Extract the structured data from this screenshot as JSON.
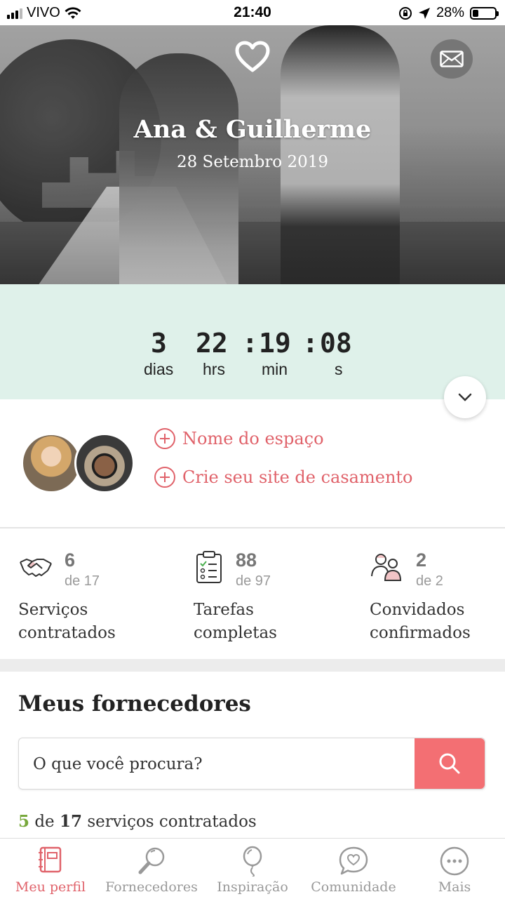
{
  "status_bar": {
    "carrier": "VIVO",
    "time": "21:40",
    "battery_percent": "28%",
    "battery_level": 0.28
  },
  "hero": {
    "couple_name": "Ana & Guilherme",
    "wedding_date": "28 Setembro 2019"
  },
  "countdown": {
    "days": "3",
    "hours": "22",
    "minutes": "19",
    "seconds": "08",
    "days_label": "dias",
    "hours_label": "hrs",
    "minutes_label": "min",
    "seconds_label": "s"
  },
  "profile": {
    "venue_link": "Nome do espaço",
    "website_link": "Crie seu site de casamento"
  },
  "stats": [
    {
      "icon": "handshake-icon",
      "count": "6",
      "total": "de 17",
      "label": "Serviços\ncontratados"
    },
    {
      "icon": "clipboard-checklist-icon",
      "count": "88",
      "total": "de 97",
      "label": "Tarefas\ncompletas"
    },
    {
      "icon": "guests-icon",
      "count": "2",
      "total": "de 2",
      "label": "Convidados\nconfirmados"
    }
  ],
  "vendors": {
    "title": "Meus fornecedores",
    "search_placeholder": "O que você procura?",
    "hired_count": "5",
    "hired_of": "de",
    "hired_total": "17",
    "hired_suffix": "serviços contratados"
  },
  "tabs": [
    {
      "label": "Meu perfil",
      "icon": "planner-icon",
      "active": true
    },
    {
      "label": "Fornecedores",
      "icon": "magnifier-icon",
      "active": false
    },
    {
      "label": "Inspiração",
      "icon": "balloon-icon",
      "active": false
    },
    {
      "label": "Comunidade",
      "icon": "chat-heart-icon",
      "active": false
    },
    {
      "label": "Mais",
      "icon": "more-dots-icon",
      "active": false
    }
  ],
  "colors": {
    "accent": "#e0626a",
    "mint": "#dff1ea",
    "search_button": "#f36f73",
    "count_green": "#77a83b"
  }
}
